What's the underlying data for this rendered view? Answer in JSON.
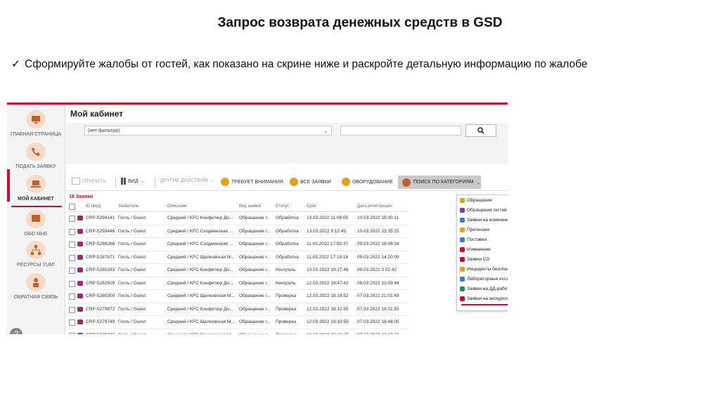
{
  "slide": {
    "title": "Запрос возврата денежных средств в GSD",
    "instruction": "Сформируйте жалобы от гостей, как показано на скрине ниже и раскройте детальную информацию по жалобе",
    "check_glyph": "✓"
  },
  "sidebar": {
    "items": [
      {
        "label": "ГЛАВНАЯ СТРАНИЦА",
        "icon": "monitor-icon"
      },
      {
        "label": "ПОДАТЬ ЗАЯВКУ",
        "icon": "phone-icon"
      },
      {
        "label": "МОЙ КАБИНЕТ",
        "icon": "laptop-icon"
      },
      {
        "label": "ОБО МНЕ",
        "icon": "screen-icon"
      },
      {
        "label": "РЕСУРСЫ YUM!",
        "icon": "network-icon"
      },
      {
        "label": "ОБРАТНАЯ СВЯЗЬ",
        "icon": "person-icon"
      }
    ],
    "active_index": 2,
    "help_glyph": "?"
  },
  "header": {
    "title": "Мой кабинет"
  },
  "filter": {
    "select_value": "(нет фильтра)"
  },
  "toolbar": {
    "open": "ОТКРЫТЬ",
    "view": "ВИД",
    "other_actions": "ДРУГИЕ ДЕЙСТВИЯ",
    "attention": "ТРЕБУЕТ ВНИМАНИЯ",
    "all_requests": "ВСЕ ЗАЯВКИ",
    "equipment": "ОБОРУДОВАНИЕ",
    "category_search": "ПОИСК ПО КАТЕГОРИЯМ"
  },
  "table": {
    "count_label": "18 Заявки",
    "headers": [
      "ID (вид)",
      "Заявитель",
      "Описание",
      "Вид заявки",
      "Статус",
      "Срок",
      "Дата регистрации"
    ],
    "rows": [
      [
        "CRP-5294141",
        "Гость / Guest",
        "Средний / KFC Конфитюр До...",
        "Обращение г...",
        "Обработка",
        "13.03.2022 11:08:05",
        "10.03.2022 18:00:11"
      ],
      [
        "CRP-5293446",
        "Гость / Guest",
        "Средний / KFC Сходненская ...",
        "Обращение г...",
        "Обработка",
        "13.03.2022 9:12:45",
        "10.03.2022 15:35:25"
      ],
      [
        "CRP-5288268",
        "Гость / Guest",
        "Средний / KFC Сходненская ...",
        "Обращение г...",
        "Обработка",
        "11.03.2022 17:50:37",
        "09.03.2022 16:08:34"
      ],
      [
        "CRP-5287871",
        "Гость / Guest",
        "Средний / KFC Щелковская М...",
        "Обращение г...",
        "Обработка",
        "11.03.2022 17:19:18",
        "09.03.2022 14:20:09"
      ],
      [
        "CRP-5285283",
        "Гость / Guest",
        "Средний / KFC Конфитюр До...",
        "Обращение г...",
        "Контроль",
        "13.03.2022 19:27:48",
        "09.03.2022 3:02:42"
      ],
      [
        "CRP-5282509",
        "Гость / Guest",
        "Средний / KFC Конфитюр До...",
        "Обращение г...",
        "Контроль",
        "12.03.2022 18:47:42",
        "08.03.2022 13:09:44"
      ],
      [
        "CRP-5280200",
        "Гость / Guest",
        "Средний / KFC Щелковская М...",
        "Обращение г...",
        "Проверка",
        "12.03.2022 18:14:52",
        "07.03.2022 21:01:49"
      ],
      [
        "CRP-5279872",
        "Гость / Guest",
        "Средний / KFC Конфитюр До...",
        "Обращение г...",
        "Проверка",
        "12.03.2022 18:12:55",
        "07.03.2022 19:31:55"
      ],
      [
        "CRP-5279749",
        "Гость / Guest",
        "Средний / KFC Щелковская М...",
        "Обращение г...",
        "Проверка",
        "12.03.2022 18:10:55",
        "07.03.2022 18:48:05"
      ],
      [
        "CRP-5279748",
        "Гость / Guest",
        "Средний / KFC Щелковская М...",
        "Обращение г...",
        "Проверка",
        "12.03.2022 18:10:27",
        "07.03.2022 18:47:38"
      ]
    ]
  },
  "dropdown": {
    "items": [
      {
        "label": "Обращения",
        "color": "#e0a020"
      },
      {
        "label": "Обращения гостей",
        "color": "#7b3fa0"
      },
      {
        "label": "Заявки на изменение",
        "color": "#3a7bd5"
      },
      {
        "label": "Претензии",
        "color": "#e0a020"
      },
      {
        "label": "Поставки",
        "color": "#3a7bd5"
      },
      {
        "label": "Изменения",
        "color": "#c8102e"
      },
      {
        "label": "Заявки СО",
        "color": "#c8102e"
      },
      {
        "label": "Инциденты безопасности",
        "color": "#e0a020"
      },
      {
        "label": "Лабораторные исследования",
        "color": "#3a7bd5"
      },
      {
        "label": "Заявки на ДД-работы",
        "color": "#2e8b57"
      },
      {
        "label": "Заявки на экскурсию",
        "color": "#c8102e"
      }
    ],
    "highlighted_index": 1
  },
  "colors": {
    "accent": "#c8102e",
    "dropdown_button": "#c9c9c9"
  }
}
